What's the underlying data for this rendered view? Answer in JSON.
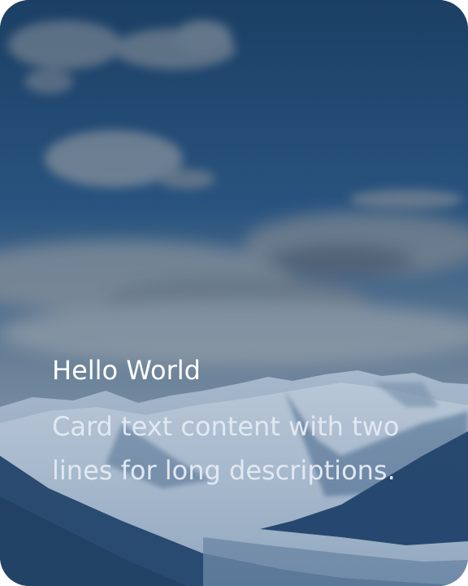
{
  "card": {
    "title": "Hello World",
    "text": "Card text content with two lines for long descriptions."
  },
  "colors": {
    "sky_top": "#1a3c5e",
    "sky_mid": "#2b557f",
    "mountain_snow": "#d9e2ec",
    "mountain_shadow": "#2f5078",
    "overlay": "#1e4a7a",
    "title_text": "#ffffff",
    "body_text": "#e1e8f2"
  },
  "background": {
    "image": "mountain-landscape"
  }
}
